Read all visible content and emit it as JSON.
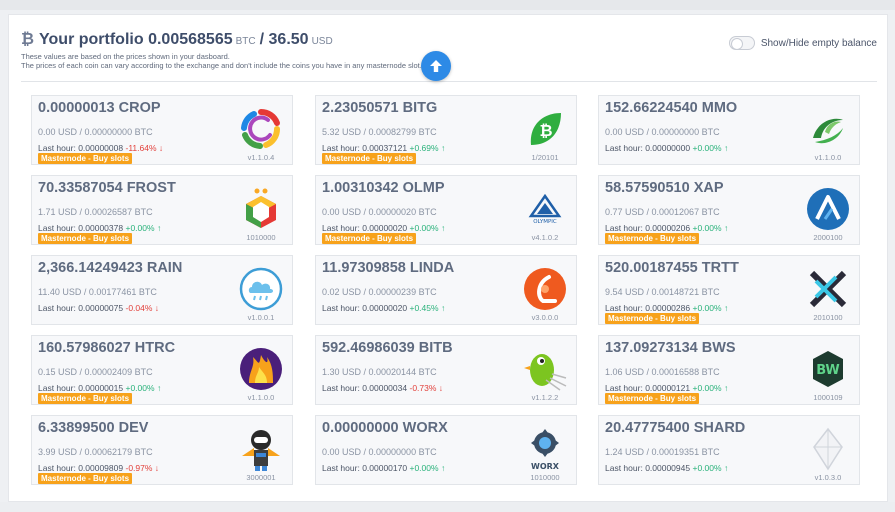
{
  "header": {
    "title_prefix": "Your portfolio",
    "btc_total": "0.00568565",
    "btc_unit": "BTC",
    "separator": "/",
    "usd_total": "36.50",
    "usd_unit": "USD",
    "note_line1": "These values are based on the prices shown in your dasboard.",
    "note_line2": "The prices of each coin can vary according to the exchange and don't include the coins you have in any masternode slot.",
    "toggle_label": "Show/Hide empty balance"
  },
  "labels": {
    "last_hour": "Last hour:",
    "badge": "Masternode - Buy slots"
  },
  "coins": [
    {
      "amount": "0.00000013 CROP",
      "usd_btc": "0.00 USD / 0.00000000 BTC",
      "last_hour_value": "0.00000008",
      "change": "-11.64%",
      "direction": "down",
      "badge": true,
      "version": "v1.1.0.4",
      "icon": "crop-logo-icon"
    },
    {
      "amount": "2.23050571 BITG",
      "usd_btc": "5.32 USD / 0.00082799 BTC",
      "last_hour_value": "0.00037121",
      "change": "+0.69%",
      "direction": "up",
      "badge": true,
      "version": "1/20101",
      "icon": "bitg-leaf-logo-icon"
    },
    {
      "amount": "152.66224540 MMO",
      "usd_btc": "0.00 USD / 0.00000000 BTC",
      "last_hour_value": "0.00000000",
      "change": "+0.00%",
      "direction": "up",
      "badge": false,
      "version": "v1.1.0.0",
      "icon": "mmo-logo-icon"
    },
    {
      "amount": "70.33587054 FROST",
      "usd_btc": "1.71 USD / 0.00026587 BTC",
      "last_hour_value": "0.00000378",
      "change": "+0.00%",
      "direction": "up",
      "badge": true,
      "version": "1010000",
      "icon": "frost-hexagon-logo-icon"
    },
    {
      "amount": "1.00310342 OLMP",
      "usd_btc": "0.00 USD / 0.00000020 BTC",
      "last_hour_value": "0.00000020",
      "change": "+0.00%",
      "direction": "up",
      "badge": true,
      "version": "v4.1.0.2",
      "icon": "olympic-logo-icon",
      "logo_text": "OLYMPIC"
    },
    {
      "amount": "58.57590510 XAP",
      "usd_btc": "0.77 USD / 0.00012067 BTC",
      "last_hour_value": "0.00000206",
      "change": "+0.00%",
      "direction": "up",
      "badge": true,
      "version": "2000100",
      "icon": "xap-logo-icon"
    },
    {
      "amount": "2,366.14249423 RAIN",
      "usd_btc": "11.40 USD / 0.00177461 BTC",
      "last_hour_value": "0.00000075",
      "change": "-0.04%",
      "direction": "down",
      "badge": false,
      "version": "v1.0.0.1",
      "icon": "rain-cloud-logo-icon"
    },
    {
      "amount": "11.97309858 LINDA",
      "usd_btc": "0.02 USD / 0.00000239 BTC",
      "last_hour_value": "0.00000020",
      "change": "+0.45%",
      "direction": "up",
      "badge": false,
      "version": "v3.0.0.0",
      "icon": "linda-logo-icon"
    },
    {
      "amount": "520.00187455 TRTT",
      "usd_btc": "9.54 USD / 0.00148721 BTC",
      "last_hour_value": "0.00000286",
      "change": "+0.00%",
      "direction": "up",
      "badge": true,
      "version": "2010100",
      "icon": "trtt-cross-logo-icon"
    },
    {
      "amount": "160.57986027 HTRC",
      "usd_btc": "0.15 USD / 0.00002409 BTC",
      "last_hour_value": "0.00000015",
      "change": "+0.00%",
      "direction": "up",
      "badge": true,
      "version": "v1.1.0.0",
      "icon": "htrc-flame-logo-icon"
    },
    {
      "amount": "592.46986039 BITB",
      "usd_btc": "1.30 USD / 0.00020144 BTC",
      "last_hour_value": "0.00000034",
      "change": "-0.73%",
      "direction": "down",
      "badge": false,
      "version": "v1.1.2.2",
      "icon": "bitb-bird-logo-icon"
    },
    {
      "amount": "137.09273134 BWS",
      "usd_btc": "1.06 USD / 0.00016588 BTC",
      "last_hour_value": "0.00000121",
      "change": "+0.00%",
      "direction": "up",
      "badge": true,
      "version": "1000109",
      "icon": "bws-logo-icon"
    },
    {
      "amount": "6.33899500 DEV",
      "usd_btc": "3.99 USD / 0.00062179 BTC",
      "last_hour_value": "0.00009809",
      "change": "-0.97%",
      "direction": "down",
      "badge": true,
      "version": "3000001",
      "icon": "dev-astronaut-logo-icon"
    },
    {
      "amount": "0.00000000 WORX",
      "usd_btc": "0.00 USD / 0.00000000 BTC",
      "last_hour_value": "0.00000170",
      "change": "+0.00%",
      "direction": "up",
      "badge": false,
      "version": "1010000",
      "icon": "worx-gear-logo-icon",
      "logo_text": "WORX"
    },
    {
      "amount": "20.47775400 SHARD",
      "usd_btc": "1.24 USD / 0.00019351 BTC",
      "last_hour_value": "0.00000945",
      "change": "+0.00%",
      "direction": "up",
      "badge": false,
      "version": "v1.0.3.0",
      "icon": "shard-crystal-logo-icon"
    }
  ]
}
